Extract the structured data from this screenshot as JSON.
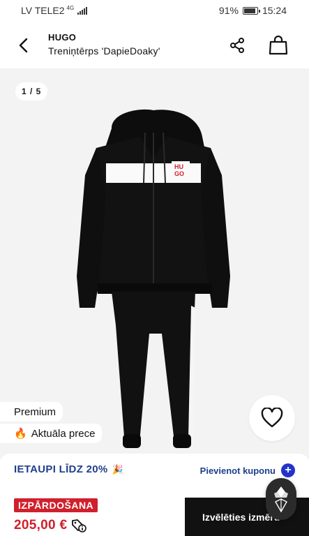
{
  "status_bar": {
    "carrier": "LV TELE2",
    "network": "4G",
    "battery": "91%",
    "battery_level": 0.91,
    "time": "15:24"
  },
  "header": {
    "brand": "HUGO",
    "product_name": "Treniņtērps 'DapieDoaky'",
    "icons": {
      "back": "back-arrow-icon",
      "share": "share-icon",
      "bag": "shopping-bag-icon"
    }
  },
  "gallery": {
    "counter": "1 / 5",
    "garment_logo": [
      "HU",
      "GO"
    ]
  },
  "tags": {
    "premium": "Premium",
    "hot_icon": "🔥",
    "hot": "Aktuāla prece"
  },
  "favorite": {
    "icon": "heart-icon"
  },
  "purchase": {
    "promo": "IETAUPI LĪDZ 20%",
    "promo_icon": "🎉",
    "add_coupon": "Pievienot kuponu",
    "sale_badge": "IZPĀRDOŠANA",
    "price": "205,00 €",
    "price_info_icon": "price-tag-info-icon",
    "select_size": "Izvēlēties izmēru"
  },
  "colors": {
    "accent_blue": "#1f3f8c",
    "coupon_button": "#2233cc",
    "sale_red": "#d0202c",
    "cta_black": "#111111",
    "gallery_bg": "#f3f3f3"
  }
}
